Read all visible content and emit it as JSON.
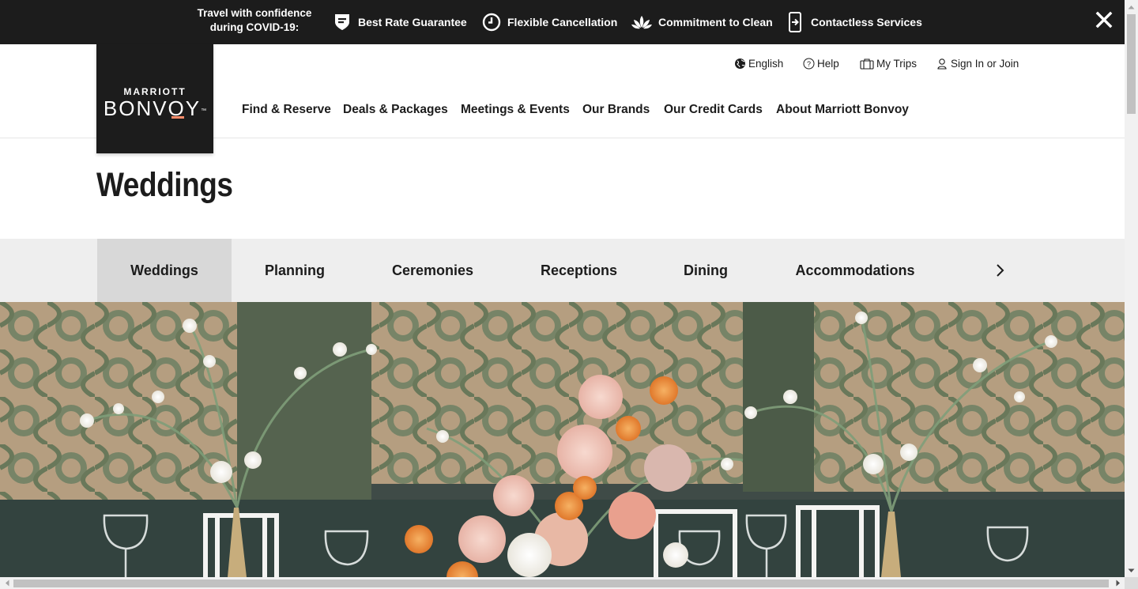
{
  "banner": {
    "lead": "Travel with confidence during COVID-19:",
    "items": [
      {
        "label": "Best Rate Guarantee",
        "icon": "shield-icon"
      },
      {
        "label": "Flexible Cancellation",
        "icon": "clock-icon"
      },
      {
        "label": "Commitment to Clean",
        "icon": "lotus-icon"
      },
      {
        "label": "Contactless Services",
        "icon": "phone-entry-icon"
      }
    ],
    "close_icon": "close-icon"
  },
  "logo": {
    "top": "MARRIOTT",
    "bottom": "BONVOY",
    "trademark": "™"
  },
  "utility_nav": [
    {
      "label": "English",
      "icon": "globe-icon"
    },
    {
      "label": "Help",
      "icon": "help-icon"
    },
    {
      "label": "My Trips",
      "icon": "suitcase-icon"
    },
    {
      "label": "Sign In or Join",
      "icon": "user-icon"
    }
  ],
  "main_nav": [
    "Find & Reserve",
    "Deals & Packages",
    "Meetings & Events",
    "Our Brands",
    "Our Credit Cards",
    "About Marriott Bonvoy"
  ],
  "page_title": "Weddings",
  "tabs": {
    "items": [
      "Weddings",
      "Planning",
      "Ceremonies",
      "Receptions",
      "Dining",
      "Accommodations"
    ],
    "active": "Weddings",
    "next_icon": "chevron-right-icon"
  },
  "colors": {
    "banner_bg": "#1c1c1c",
    "logo_bg": "#1c1c1c",
    "accent": "#ff8d6b",
    "tabs_bg": "#eeeeee",
    "tab_active_bg": "#d8d8d8"
  }
}
